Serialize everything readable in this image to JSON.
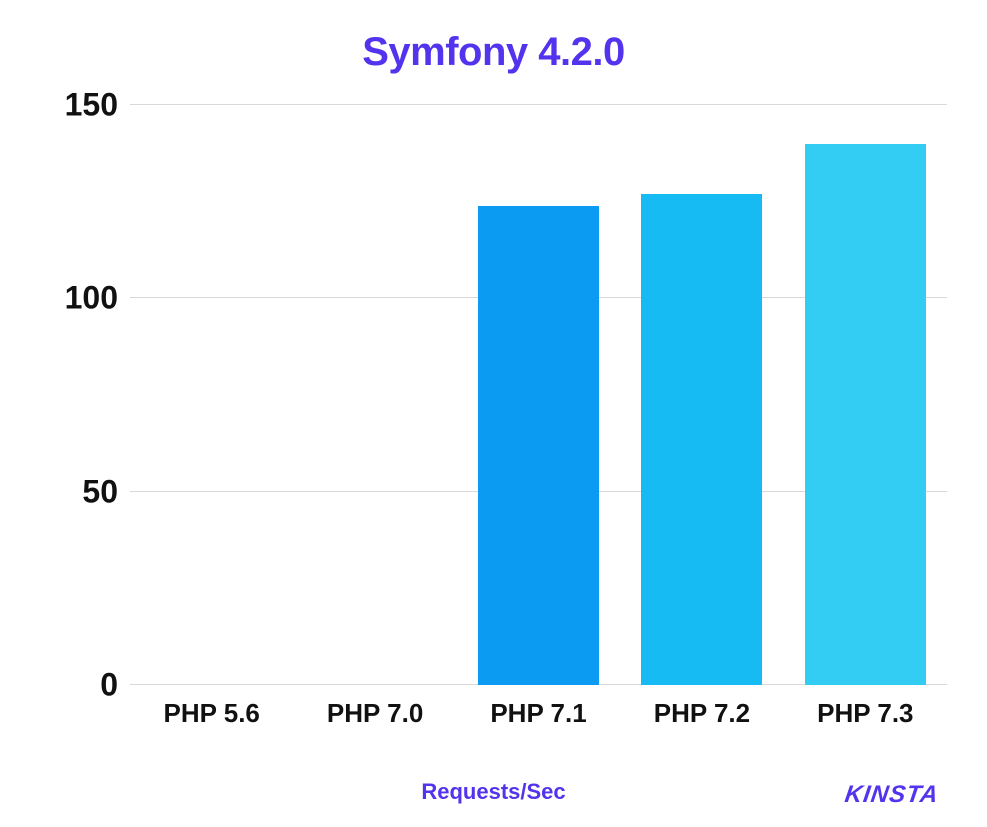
{
  "chart_data": {
    "type": "bar",
    "title": "Symfony 4.2.0",
    "xlabel": "Requests/Sec",
    "ylabel": "",
    "categories": [
      "PHP 5.6",
      "PHP 7.0",
      "PHP 7.1",
      "PHP 7.2",
      "PHP 7.3"
    ],
    "values": [
      0,
      0,
      124,
      127,
      140
    ],
    "colors": [
      "#0B9BF2",
      "#0B9BF2",
      "#0B9BF2",
      "#17BBF3",
      "#33CDF4"
    ],
    "ylim": [
      0,
      150
    ],
    "yticks": [
      0,
      50,
      100,
      150
    ]
  },
  "brand": "KINSTA",
  "accent_color": "#5333ED"
}
